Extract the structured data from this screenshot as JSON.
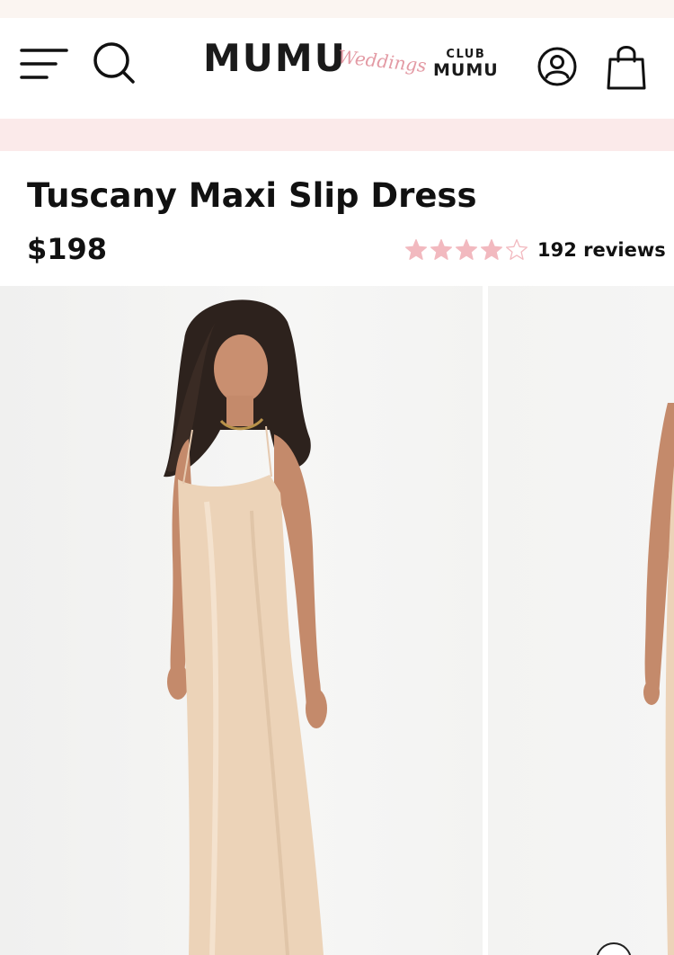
{
  "header": {
    "logo_main": "MUMU",
    "logo_script": "Weddings",
    "club_top": "CLUB",
    "club_bottom": "MUMU",
    "icons": {
      "menu": "hamburger-menu-icon",
      "search": "search-icon",
      "account": "account-icon",
      "cart": "shopping-bag-icon"
    }
  },
  "product": {
    "title": "Tuscany Maxi Slip Dress",
    "price": "$198",
    "rating": {
      "value": 4,
      "max": 5,
      "reviews_label": "192 reviews"
    }
  },
  "colors": {
    "star_filled": "#f2b9bf",
    "promo_bar": "#fbeaea",
    "top_strip": "#fbf5f1",
    "logo_script": "#e39aa4"
  }
}
